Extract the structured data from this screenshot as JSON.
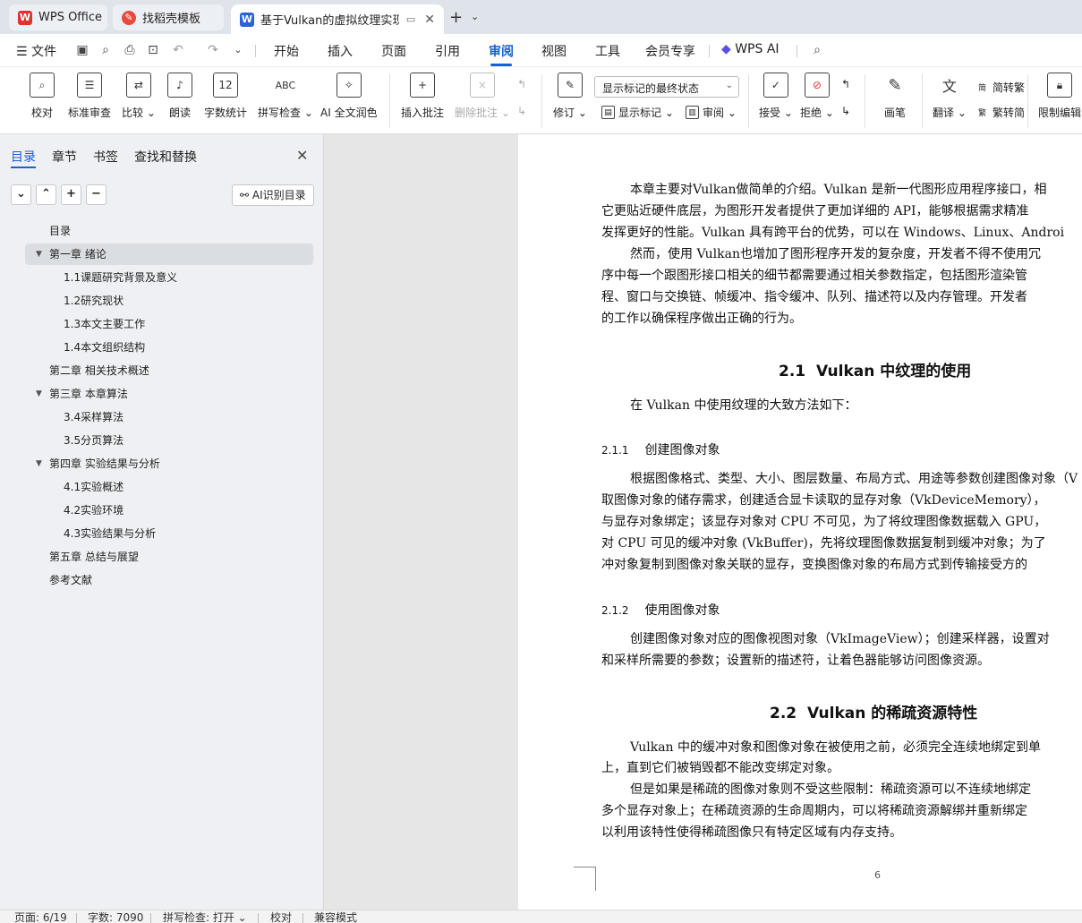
{
  "tabs": [
    {
      "label": "WPS Office",
      "icon": "wps-logo-icon"
    },
    {
      "label": "找稻壳模板",
      "icon": "docer-icon"
    },
    {
      "label": "基于Vulkan的虚拟纹理实现 与",
      "icon": "word-doc-icon",
      "active": true
    }
  ],
  "menu": {
    "file": "文件",
    "items": [
      "开始",
      "插入",
      "页面",
      "引用",
      "审阅",
      "视图",
      "工具",
      "会员专享"
    ],
    "active": "审阅",
    "wps_ai": "WPS AI"
  },
  "ribbon": {
    "proofread": "校对",
    "standard_review": "标准审查",
    "compare": "比较",
    "read_aloud": "朗读",
    "word_count": "字数统计",
    "spell_check": "拼写检查",
    "ai_polish": "AI 全文润色",
    "insert_comment": "插入批注",
    "delete_comment": "删除批注",
    "track_changes": "修订",
    "markup_mode": "显示标记的最终状态",
    "show_markup": "显示标记",
    "review_pane": "审阅",
    "accept": "接受",
    "reject": "拒绝",
    "ink": "画笔",
    "translate": "翻译",
    "to_traditional": "简转繁",
    "to_simplified": "繁转简",
    "restrict_editing": "限制编辑"
  },
  "nav": {
    "tabs": [
      "目录",
      "章节",
      "书签",
      "查找和替换"
    ],
    "active_tab": "目录",
    "ai_toc": "AI识别目录",
    "toc": [
      {
        "label": "目录",
        "level": 1,
        "expand": ""
      },
      {
        "label": "第一章 绪论",
        "level": 1,
        "expand": "▼",
        "selected": true
      },
      {
        "label": "1.1课题研究背景及意义",
        "level": 2,
        "expand": ""
      },
      {
        "label": "1.2研究现状",
        "level": 2,
        "expand": ""
      },
      {
        "label": "1.3本文主要工作",
        "level": 2,
        "expand": ""
      },
      {
        "label": "1.4本文组织结构",
        "level": 2,
        "expand": ""
      },
      {
        "label": "第二章 相关技术概述",
        "level": 1,
        "expand": ""
      },
      {
        "label": "第三章 本章算法",
        "level": 1,
        "expand": "▼"
      },
      {
        "label": "3.4采样算法",
        "level": 2,
        "expand": ""
      },
      {
        "label": "3.5分页算法",
        "level": 2,
        "expand": ""
      },
      {
        "label": "第四章 实验结果与分析",
        "level": 1,
        "expand": "▼"
      },
      {
        "label": "4.1实验概述",
        "level": 2,
        "expand": ""
      },
      {
        "label": "4.2实验环境",
        "level": 2,
        "expand": ""
      },
      {
        "label": "4.3实验结果与分析",
        "level": 2,
        "expand": ""
      },
      {
        "label": "第五章 总结与展望",
        "level": 1,
        "expand": ""
      },
      {
        "label": "参考文献",
        "level": 1,
        "expand": ""
      }
    ]
  },
  "document": {
    "intro": [
      "本章主要对Vulkan做简单的介绍。Vulkan 是新一代图形应用程序接口，相",
      "它更贴近硬件底层，为图形开发者提供了更加详细的 API，能够根据需求精准",
      "发挥更好的性能。Vulkan 具有跨平台的优势，可以在 Windows、Linux、Androi",
      "然而，使用 Vulkan也增加了图形程序开发的复杂度，开发者不得不使用冗",
      "序中每一个跟图形接口相关的细节都需要通过相关参数指定，包括图形渲染管",
      "程、窗口与交换链、帧缓冲、指令缓冲、队列、描述符以及内存管理。开发者",
      "的工作以确保程序做出正确的行为。"
    ],
    "sec_2_1": {
      "num": "2.1",
      "title": "Vulkan 中纹理的使用"
    },
    "sec_2_1_intro": "在 Vulkan 中使用纹理的大致方法如下：",
    "sec_2_1_1": {
      "num": "2.1.1",
      "title": "创建图像对象"
    },
    "sec_2_1_1_body": [
      "根据图像格式、类型、大小、图层数量、布局方式、用途等参数创建图像对象（V",
      "取图像对象的储存需求，创建适合显卡读取的显存对象（VkDeviceMemory），",
      "与显存对象绑定；该显存对象对 CPU 不可见，为了将纹理图像数据载入 GPU，",
      "对 CPU 可见的缓冲对象 (VkBuffer)，先将纹理图像数据复制到缓冲对象；为了",
      "冲对象复制到图像对象关联的显存，变换图像对象的布局方式到传输接受方的"
    ],
    "sec_2_1_2": {
      "num": "2.1.2",
      "title": "使用图像对象"
    },
    "sec_2_1_2_body": [
      "创建图像对象对应的图像视图对象（VkImageView）；创建采样器，设置对",
      "和采样所需要的参数；设置新的描述符，让着色器能够访问图像资源。"
    ],
    "sec_2_2": {
      "num": "2.2",
      "title": "Vulkan 的稀疏资源特性"
    },
    "sec_2_2_body": [
      "Vulkan  中的缓冲对象和图像对象在被使用之前，必须完全连续地绑定到单",
      "上，直到它们被销毁都不能改变绑定对象。",
      "但是如果是稀疏的图像对象则不受这些限制：稀疏资源可以不连续地绑定",
      "多个显存对象上；在稀疏资源的生命周期内，可以将稀疏资源解绑并重新绑定",
      "以利用该特性使得稀疏图像只有特定区域有内存支持。"
    ],
    "page_number": "6"
  },
  "status": {
    "page": "页面: 6/19",
    "words": "字数: 7090",
    "spell": "拼写检查: 打开",
    "proof": "校对",
    "compat": "兼容模式"
  },
  "colors": {
    "accent": "#1a5fd6",
    "wps_red": "#e0322e",
    "docer_red": "#e84a3c",
    "word_blue": "#2b62d9"
  }
}
